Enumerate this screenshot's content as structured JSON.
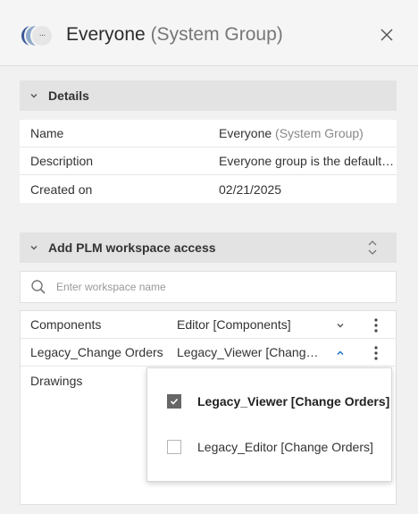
{
  "header": {
    "title_main": "Everyone",
    "title_suffix": "(System Group)",
    "avatar_more": "···",
    "close_icon": "close-icon"
  },
  "details": {
    "section_label": "Details",
    "rows": [
      {
        "key": "Name",
        "value": "Everyone",
        "value_suffix": "(System Group)"
      },
      {
        "key": "Description",
        "value": "Everyone group is the default group"
      },
      {
        "key": "Created on",
        "value": "02/21/2025"
      }
    ]
  },
  "workspace_access": {
    "section_label": "Add PLM workspace access",
    "search": {
      "placeholder": "Enter workspace name",
      "value": ""
    },
    "rows": [
      {
        "name": "Components",
        "role": "Editor [Components]",
        "expanded": false
      },
      {
        "name": "Legacy_Change Orders",
        "role": "Legacy_Viewer [Change Orders]",
        "expanded": true
      },
      {
        "name": "Drawings",
        "role": "",
        "expanded": false
      }
    ],
    "dropdown_options": [
      {
        "label": "Legacy_Viewer [Change Orders]",
        "checked": true
      },
      {
        "label": "Legacy_Editor [Change Orders]",
        "checked": false
      }
    ]
  },
  "colors": {
    "accent": "#1a73c8",
    "section_bg": "#e3e3e3",
    "avatar_blue": "#3b5998"
  }
}
